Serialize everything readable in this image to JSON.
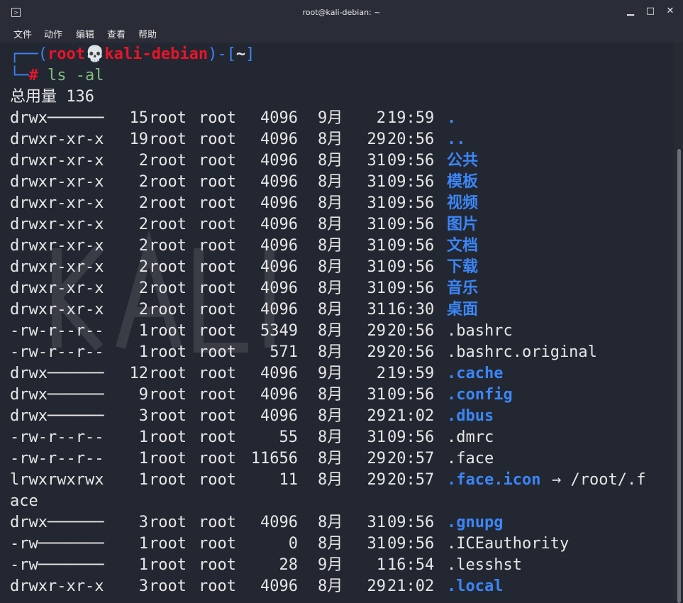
{
  "window": {
    "title": "root@kali-debian: ~",
    "menu": [
      "文件",
      "动作",
      "编辑",
      "查看",
      "帮助"
    ]
  },
  "prompt": {
    "user": "root",
    "host": "kali-debian",
    "path": "~",
    "symbol": "#",
    "command": "ls -al"
  },
  "total_line": "总用量 136",
  "colors": {
    "dir": "#3b86f7",
    "user": "#e8152a",
    "bracket": "#3b86f7",
    "text": "#e6e6e6"
  },
  "rows": [
    {
      "perm": "drwx──────",
      "links": "15",
      "owner": "root",
      "group": "root",
      "size": "4096",
      "month": "9月",
      "day": "2",
      "time": "19:59",
      "name": ".",
      "type": "dir"
    },
    {
      "perm": "drwxr-xr-x",
      "links": "19",
      "owner": "root",
      "group": "root",
      "size": "4096",
      "month": "8月",
      "day": "29",
      "time": "20:56",
      "name": "..",
      "type": "dir"
    },
    {
      "perm": "drwxr-xr-x",
      "links": "2",
      "owner": "root",
      "group": "root",
      "size": "4096",
      "month": "8月",
      "day": "31",
      "time": "09:56",
      "name": "公共",
      "type": "dir"
    },
    {
      "perm": "drwxr-xr-x",
      "links": "2",
      "owner": "root",
      "group": "root",
      "size": "4096",
      "month": "8月",
      "day": "31",
      "time": "09:56",
      "name": "模板",
      "type": "dir"
    },
    {
      "perm": "drwxr-xr-x",
      "links": "2",
      "owner": "root",
      "group": "root",
      "size": "4096",
      "month": "8月",
      "day": "31",
      "time": "09:56",
      "name": "视频",
      "type": "dir"
    },
    {
      "perm": "drwxr-xr-x",
      "links": "2",
      "owner": "root",
      "group": "root",
      "size": "4096",
      "month": "8月",
      "day": "31",
      "time": "09:56",
      "name": "图片",
      "type": "dir"
    },
    {
      "perm": "drwxr-xr-x",
      "links": "2",
      "owner": "root",
      "group": "root",
      "size": "4096",
      "month": "8月",
      "day": "31",
      "time": "09:56",
      "name": "文档",
      "type": "dir"
    },
    {
      "perm": "drwxr-xr-x",
      "links": "2",
      "owner": "root",
      "group": "root",
      "size": "4096",
      "month": "8月",
      "day": "31",
      "time": "09:56",
      "name": "下载",
      "type": "dir"
    },
    {
      "perm": "drwxr-xr-x",
      "links": "2",
      "owner": "root",
      "group": "root",
      "size": "4096",
      "month": "8月",
      "day": "31",
      "time": "09:56",
      "name": "音乐",
      "type": "dir"
    },
    {
      "perm": "drwxr-xr-x",
      "links": "2",
      "owner": "root",
      "group": "root",
      "size": "4096",
      "month": "8月",
      "day": "31",
      "time": "16:30",
      "name": "桌面",
      "type": "dir"
    },
    {
      "perm": "-rw-r--r--",
      "links": "1",
      "owner": "root",
      "group": "root",
      "size": "5349",
      "month": "8月",
      "day": "29",
      "time": "20:56",
      "name": ".bashrc",
      "type": "file"
    },
    {
      "perm": "-rw-r--r--",
      "links": "1",
      "owner": "root",
      "group": "root",
      "size": "571",
      "month": "8月",
      "day": "29",
      "time": "20:56",
      "name": ".bashrc.original",
      "type": "file"
    },
    {
      "perm": "drwx──────",
      "links": "12",
      "owner": "root",
      "group": "root",
      "size": "4096",
      "month": "9月",
      "day": "2",
      "time": "19:59",
      "name": ".cache",
      "type": "dir"
    },
    {
      "perm": "drwx──────",
      "links": "9",
      "owner": "root",
      "group": "root",
      "size": "4096",
      "month": "8月",
      "day": "31",
      "time": "09:56",
      "name": ".config",
      "type": "dir"
    },
    {
      "perm": "drwx──────",
      "links": "3",
      "owner": "root",
      "group": "root",
      "size": "4096",
      "month": "8月",
      "day": "29",
      "time": "21:02",
      "name": ".dbus",
      "type": "dir"
    },
    {
      "perm": "-rw-r--r--",
      "links": "1",
      "owner": "root",
      "group": "root",
      "size": "55",
      "month": "8月",
      "day": "31",
      "time": "09:56",
      "name": ".dmrc",
      "type": "file"
    },
    {
      "perm": "-rw-r--r--",
      "links": "1",
      "owner": "root",
      "group": "root",
      "size": "11656",
      "month": "8月",
      "day": "29",
      "time": "20:57",
      "name": ".face",
      "type": "file"
    },
    {
      "perm": "lrwxrwxrwx",
      "links": "1",
      "owner": "root",
      "group": "root",
      "size": "11",
      "month": "8月",
      "day": "29",
      "time": "20:57",
      "name": ".face.icon",
      "type": "dir",
      "link": "→ /root/.f"
    },
    {
      "wrap": "ace"
    },
    {
      "perm": "drwx──────",
      "links": "3",
      "owner": "root",
      "group": "root",
      "size": "4096",
      "month": "8月",
      "day": "31",
      "time": "09:56",
      "name": ".gnupg",
      "type": "dir"
    },
    {
      "perm": "-rw───────",
      "links": "1",
      "owner": "root",
      "group": "root",
      "size": "0",
      "month": "8月",
      "day": "31",
      "time": "09:56",
      "name": ".ICEauthority",
      "type": "file"
    },
    {
      "perm": "-rw───────",
      "links": "1",
      "owner": "root",
      "group": "root",
      "size": "28",
      "month": "9月",
      "day": "1",
      "time": "16:54",
      "name": ".lesshst",
      "type": "file"
    },
    {
      "perm": "drwxr-xr-x",
      "links": "3",
      "owner": "root",
      "group": "root",
      "size": "4096",
      "month": "8月",
      "day": "29",
      "time": "21:02",
      "name": ".local",
      "type": "dir"
    }
  ]
}
